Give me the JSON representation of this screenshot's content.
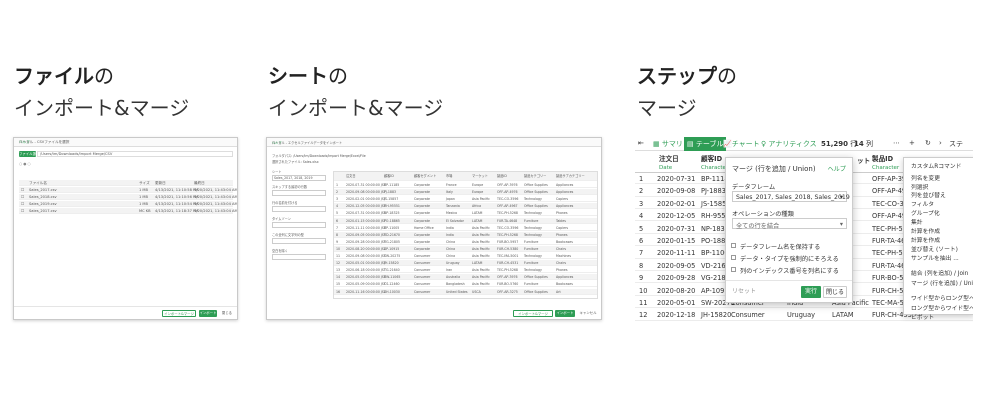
{
  "sections": [
    {
      "title": "ファイル",
      "title_suffix": "の",
      "subtitle": "インポート&マージ"
    },
    {
      "title": "シート",
      "title_suffix": "の",
      "subtitle": "インポート&マージ"
    },
    {
      "title": "ステップ",
      "title_suffix": "の",
      "subtitle": "マージ"
    }
  ],
  "file_import": {
    "header": "ローカル - CSVファイルを選択",
    "help": "ヘルプ",
    "browse": "ファイル選択",
    "path": "/Users/tm/Downloads/Import Merge/CSV",
    "columns": [
      "ファイル名",
      "サイズ",
      "更新日",
      "最終日"
    ],
    "rows": [
      [
        "Sales_2017.csv",
        "1 MB",
        "4/13/2021, 11:10:58 PM",
        "4/20/2021, 11:43:04 AM"
      ],
      [
        "Sales_2018.csv",
        "1 MB",
        "4/13/2021, 11:10:56 PM",
        "4/20/2021, 11:43:04 AM"
      ],
      [
        "Sales_2019.csv",
        "1 MB",
        "4/13/2021, 11:10:54 PM",
        "4/20/2021, 11:43:04 AM"
      ],
      [
        "Sales_2017.csv",
        "MC KB",
        "4/13/2021, 11:18:37 PM",
        "4/20/2021, 11:43:04 AM"
      ]
    ],
    "btn_merge": "インポート&マージ",
    "btn_import": "インポート",
    "btn_close": "閉じる"
  },
  "sheet_import": {
    "header": "ローカル - エクセルファイルデータをインポート",
    "help": "ヘルプ",
    "folder_label": "フォルダパス:",
    "folder": "/Users/tm/Downloads/Import Merge/Excel/File",
    "file_label": "選択されたファイル:",
    "file": "Sales.xlsx",
    "sheet_label": "シート",
    "sheet_value": "Sales_2017, 2018, 2019",
    "opts": [
      "スキップする最初の行数",
      "行の名前を付ける",
      "タイムゾーン",
      "この全列に文字列の型",
      "空白を除く"
    ],
    "columns": [
      "注文日",
      "顧客ID",
      "顧客セグメント",
      "市場",
      "マーケット",
      "製品ID",
      "製品カテゴリー",
      "製品サブカテゴリー"
    ],
    "rows": [
      [
        "2020-07-31 00:00:00 JST",
        "BP-11185",
        "Corporate",
        "France",
        "Europe",
        "OFF-AP-3976",
        "Office Supplies",
        "Appliances"
      ],
      [
        "2020-09-08 00:00:00 JST",
        "PJ-1883",
        "Corporate",
        "Italy",
        "Europe",
        "OFF-AP-4976",
        "Office Supplies",
        "Appliances"
      ],
      [
        "2020-02-01 00:00:00 JST",
        "JS-15857",
        "Corporate",
        "Japan",
        "Asia Pacific",
        "TEC-CO-3596",
        "Technology",
        "Copiers"
      ],
      [
        "2020-12-05 00:00:00 JST",
        "RH-95551",
        "Corporate",
        "Tanzania",
        "Africa",
        "OFF-AP-4967",
        "Office Supplies",
        "Appliances"
      ],
      [
        "2020-07-31 00:00:00 JST",
        "NP-18325",
        "Corporate",
        "Mexico",
        "LATAM",
        "TEC-PH-5268",
        "Technology",
        "Phones"
      ],
      [
        "2020-01-15 00:00:00 JST",
        "PO-18865",
        "Corporate",
        "El Salvador",
        "LATAM",
        "FUR-TA-4648",
        "Furniture",
        "Tables"
      ],
      [
        "2020-11-11 00:00:00 JST",
        "BP-11005",
        "Home Office",
        "India",
        "Asia Pacific",
        "TEC-CO-3596",
        "Technology",
        "Copiers"
      ],
      [
        "2020-09-05 00:00:00 JST",
        "VD-21670",
        "Corporate",
        "India",
        "Asia Pacific",
        "TEC-PH-5268",
        "Technology",
        "Phones"
      ],
      [
        "2020-09-28 00:00:00 JST",
        "VG-21805",
        "Corporate",
        "China",
        "Asia Pacific",
        "FUR-BO-5957",
        "Furniture",
        "Bookcases"
      ],
      [
        "2020-08-20 00:00:00 JST",
        "AP-10915",
        "Corporate",
        "China",
        "Asia Pacific",
        "FUR-CH-5380",
        "Furniture",
        "Chairs"
      ],
      [
        "2020-09-08 00:00:00 JST",
        "SW-20275",
        "Consumer",
        "China",
        "Asia Pacific",
        "TEC-MA-5001",
        "Technology",
        "Machines"
      ],
      [
        "2020-05-01 00:00:00 JST",
        "JH-15820",
        "Consumer",
        "Uruguay",
        "LATAM",
        "FUR-CH-4531",
        "Furniture",
        "Chairs"
      ],
      [
        "2020-06-18 00:00:00 JST",
        "TG-21640",
        "Consumer",
        "Iran",
        "Asia Pacific",
        "TEC-PH-5268",
        "Technology",
        "Phones"
      ],
      [
        "2020-05-03 00:00:00 JST",
        "BW-11065",
        "Consumer",
        "Australia",
        "Asia Pacific",
        "OFF-AP-3976",
        "Office Supplies",
        "Appliances"
      ],
      [
        "2020-05-09 00:00:00 JST",
        "CS-12460",
        "Consumer",
        "Bangladesh",
        "Asia Pacific",
        "FUR-BO-5760",
        "Furniture",
        "Bookcases"
      ],
      [
        "2020-11-16 00:00:00 JST",
        "AH-10030",
        "Consumer",
        "United States",
        "USCA",
        "OFF-AR-3275",
        "Office Supplies",
        "Art"
      ]
    ],
    "btn_merge": "インポート&マージ",
    "btn_import": "インポート",
    "btn_cancel": "キャンセル"
  },
  "step_merge": {
    "toolbar": {
      "summary": "サマリ",
      "table": "テーブル",
      "chart": "チャート",
      "analytics": "アナリティクス",
      "rows": "51,290",
      "rows_unit": "行",
      "cols": "14",
      "cols_unit": "列",
      "step": "ステ"
    },
    "columns": [
      {
        "name": "注文日",
        "type": "Date"
      },
      {
        "name": "顧客ID",
        "type": "Character"
      }
    ],
    "hidden_col_suffix": "ット",
    "product_col": "製品ID",
    "product_type": "Character",
    "rows": [
      [
        "1",
        "2020-07-31",
        "BP-11185",
        "",
        "",
        "OFF-AP-397"
      ],
      [
        "2",
        "2020-09-08",
        "PJ-18835",
        "",
        "",
        "OFF-AP-497"
      ],
      [
        "3",
        "2020-02-01",
        "JS-15857",
        "",
        "",
        "TEC-CO-359"
      ],
      [
        "4",
        "2020-12-05",
        "RH-95551",
        "",
        "",
        "OFF-AP-496"
      ],
      [
        "5",
        "2020-07-31",
        "NP-18325",
        "",
        "",
        "TEC-PH-526"
      ],
      [
        "6",
        "2020-01-15",
        "PO-18865",
        "",
        "",
        "FUR-TA-464"
      ],
      [
        "7",
        "2020-11-11",
        "BP-11005",
        "",
        "",
        "TEC-PH-526"
      ],
      [
        "8",
        "2020-09-05",
        "VD-21670",
        "",
        "",
        "FUR-TA-464"
      ],
      [
        "9",
        "2020-09-28",
        "VG-21805",
        "",
        "",
        "FUR-BO-595"
      ],
      [
        "10",
        "2020-08-20",
        "AP-10915",
        "",
        "",
        "FUR-CH-538"
      ],
      [
        "11",
        "2020-05-01",
        "SW-20275",
        "Consumer",
        "India",
        "Asia Pacific",
        "TEC-MA-500"
      ],
      [
        "12",
        "2020-12-18",
        "JH-15820",
        "Consumer",
        "Uruguay",
        "LATAM",
        "FUR-CH-453"
      ]
    ],
    "dialog": {
      "title": "マージ (行を追加 / Union)",
      "help": "ヘルプ",
      "df_label": "データフレーム",
      "df_value": "Sales_2017, Sales_2018, Sales_2019",
      "op_label": "オペレーションの種類",
      "op_value": "全ての行を結合",
      "checks": [
        "データフレーム名を保持する",
        "データ・タイプを強制的にそろえる",
        "列のインデックス番号を列名にする"
      ],
      "reset": "リセット",
      "run": "実行",
      "close": "閉じる"
    },
    "menu": {
      "items": [
        "カスタムRコマンド",
        "列名を変更",
        "列選択",
        "列を並び替え",
        "フィルタ",
        "グループ化",
        "集計",
        "計算を作成",
        "計算を作成",
        "並び替え (ソート)",
        "サンプルを抽出 ...",
        "結合 (列を追加) / Join",
        "マージ (行を追加) / Union",
        "ワイド型からロング型へ",
        "ロング型からワイド型へ",
        "ピボット"
      ]
    }
  }
}
